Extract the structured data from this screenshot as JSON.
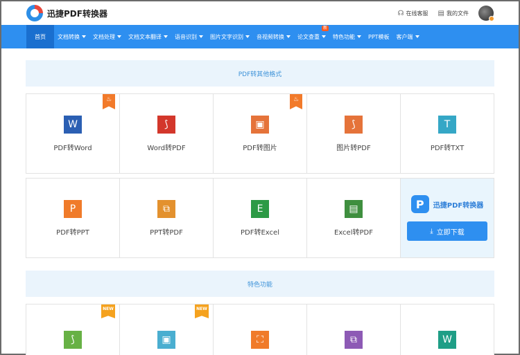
{
  "header": {
    "brand_name": "迅捷PDF转换器",
    "online_service": "在线客服",
    "my_files": "我的文件"
  },
  "nav": [
    {
      "label": "首页",
      "active": true,
      "caret": false
    },
    {
      "label": "文档转换",
      "caret": true
    },
    {
      "label": "文档处理",
      "caret": true
    },
    {
      "label": "文档文本翻译",
      "caret": true
    },
    {
      "label": "语音识别",
      "caret": true
    },
    {
      "label": "图片文字识别",
      "caret": true
    },
    {
      "label": "音视频转换",
      "caret": true
    },
    {
      "label": "论文查重",
      "caret": true,
      "badge": "新"
    },
    {
      "label": "特色功能",
      "caret": true
    },
    {
      "label": "PPT模板",
      "caret": false
    },
    {
      "label": "客户端",
      "caret": true
    }
  ],
  "section1": {
    "title": "PDF转其他格式"
  },
  "row1": [
    {
      "label": "PDF转Word",
      "glyph": "W",
      "color": "#2b5fb3",
      "icon": "word-icon",
      "tag": "fire"
    },
    {
      "label": "Word转PDF",
      "glyph": "⟆",
      "color": "#d3372b",
      "icon": "pdf-icon",
      "tag": ""
    },
    {
      "label": "PDF转图片",
      "glyph": "▣",
      "color": "#e5733a",
      "icon": "image-icon",
      "tag": "fire"
    },
    {
      "label": "图片转PDF",
      "glyph": "⟆",
      "color": "#e5733a",
      "icon": "pdf-icon",
      "tag": ""
    },
    {
      "label": "PDF转TXT",
      "glyph": "T",
      "color": "#35a7c6",
      "icon": "txt-icon",
      "tag": ""
    }
  ],
  "row2": [
    {
      "label": "PDF转PPT",
      "glyph": "P",
      "color": "#f07b2a",
      "icon": "ppt-icon"
    },
    {
      "label": "PPT转PDF",
      "glyph": "⧉",
      "color": "#e3912e",
      "icon": "ppt-pdf-icon"
    },
    {
      "label": "PDF转Excel",
      "glyph": "E",
      "color": "#2c9a45",
      "icon": "excel-icon"
    },
    {
      "label": "Excel转PDF",
      "glyph": "▤",
      "color": "#3f8f3f",
      "icon": "excel-pdf-icon"
    }
  ],
  "promo": {
    "logo_glyph": "P",
    "name": "迅捷PDF转换器",
    "download_label": "立即下载"
  },
  "section2": {
    "title": "特色功能"
  },
  "row3": [
    {
      "glyph": "⟆",
      "color": "#67b145",
      "icon": "pdf-icon",
      "tag": "NEW"
    },
    {
      "glyph": "▣",
      "color": "#4aaed0",
      "icon": "image-icon",
      "tag": "NEW"
    },
    {
      "glyph": "⛶",
      "color": "#f07b2a",
      "icon": "scan-icon",
      "tag": ""
    },
    {
      "glyph": "⧉",
      "color": "#8d5ab5",
      "icon": "copy-icon",
      "tag": ""
    },
    {
      "glyph": "W",
      "color": "#1f9e86",
      "icon": "word-icon",
      "tag": ""
    }
  ]
}
